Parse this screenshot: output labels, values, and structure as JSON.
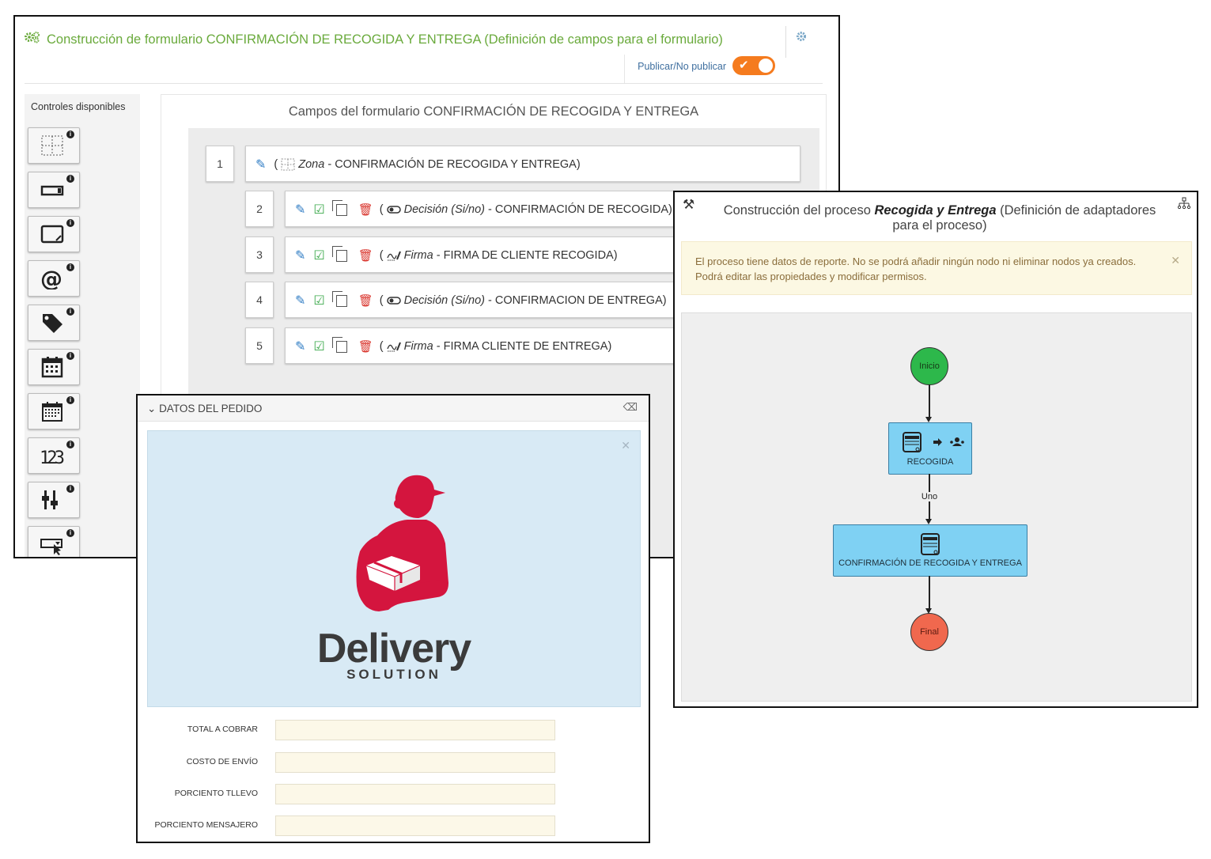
{
  "form_builder": {
    "title": "Construcción de formulario CONFIRMACIÓN DE RECOGIDA Y ENTREGA (Definición de campos para el formulario)",
    "publish_label": "Publicar/No publicar",
    "publish_on": true,
    "controls_title": "Controles disponibles",
    "controls": [
      "zone-icon",
      "textbox-icon",
      "textarea-icon",
      "email-at-icon",
      "tag-icon",
      "calendar-icon",
      "datetime-calendar-icon",
      "number-123-icon",
      "slider-icon",
      "select-cursor-icon"
    ],
    "fields_title": "Campos del formulario CONFIRMACIÓN DE RECOGIDA Y ENTREGA",
    "fields": [
      {
        "num": "1",
        "type": "Zona",
        "name": "CONFIRMACIÓN DE RECOGIDA Y ENTREGA)"
      },
      {
        "num": "2",
        "type": "Decisión (Si/no)",
        "name": "CONFIRMACIÓN DE RECOGIDA)"
      },
      {
        "num": "3",
        "type": "Firma",
        "name": "FIRMA DE CLIENTE RECOGIDA)"
      },
      {
        "num": "4",
        "type": "Decisión (Si/no)",
        "name": "CONFIRMACION DE ENTREGA)"
      },
      {
        "num": "5",
        "type": "Firma",
        "name": "FIRMA CLIENTE DE ENTREGA)"
      }
    ]
  },
  "process_builder": {
    "title_prefix": "Construcción del proceso ",
    "process_name": "Recogida y Entrega",
    "title_suffix": " (Definición de adaptadores para el proceso)",
    "alert": "El proceso tiene datos de reporte. No se podrá añadir ningún nodo ni eliminar nodos ya creados. Podrá editar las propiedades y modificar permisos.",
    "nodes": {
      "start": "Inicio",
      "recogida": "RECOGIDA",
      "edge_label": "Uno",
      "confirmacion": "CONFIRMACIÓN DE RECOGIDA Y ENTREGA",
      "end": "Final"
    },
    "colors": {
      "start": "#2db84b",
      "task": "#7fd1f3",
      "end": "#f0684e",
      "alert_bg": "#fcf8e3"
    }
  },
  "order_panel": {
    "title": "DATOS DEL PEDIDO",
    "logo_word": "Delivery",
    "logo_sub": "SOLUTION",
    "logo_color": "#d4153e",
    "fields": [
      {
        "label": "TOTAL A COBRAR",
        "value": ""
      },
      {
        "label": "COSTO DE ENVÍO",
        "value": ""
      },
      {
        "label": "PORCIENTO TLLEVO",
        "value": ""
      },
      {
        "label": "PORCIENTO MENSAJERO",
        "value": ""
      }
    ]
  }
}
